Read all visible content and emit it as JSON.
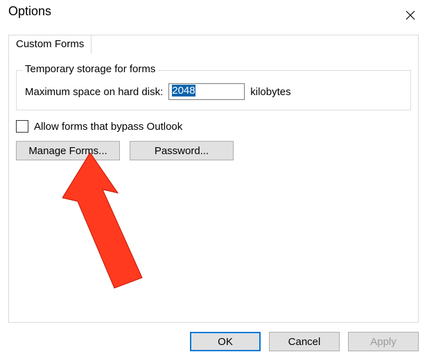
{
  "window": {
    "title": "Options"
  },
  "tab": {
    "label": "Custom Forms"
  },
  "group": {
    "legend": "Temporary storage for forms",
    "max_label": "Maximum space on hard disk:",
    "max_value": "2048",
    "unit": "kilobytes"
  },
  "bypass": {
    "label": "Allow forms that bypass Outlook",
    "checked": false
  },
  "buttons": {
    "manage": "Manage Forms...",
    "password": "Password..."
  },
  "actions": {
    "ok": "OK",
    "cancel": "Cancel",
    "apply": "Apply"
  },
  "annotation": {
    "color": "#ff3a1f",
    "target": "manage-forms-button"
  }
}
